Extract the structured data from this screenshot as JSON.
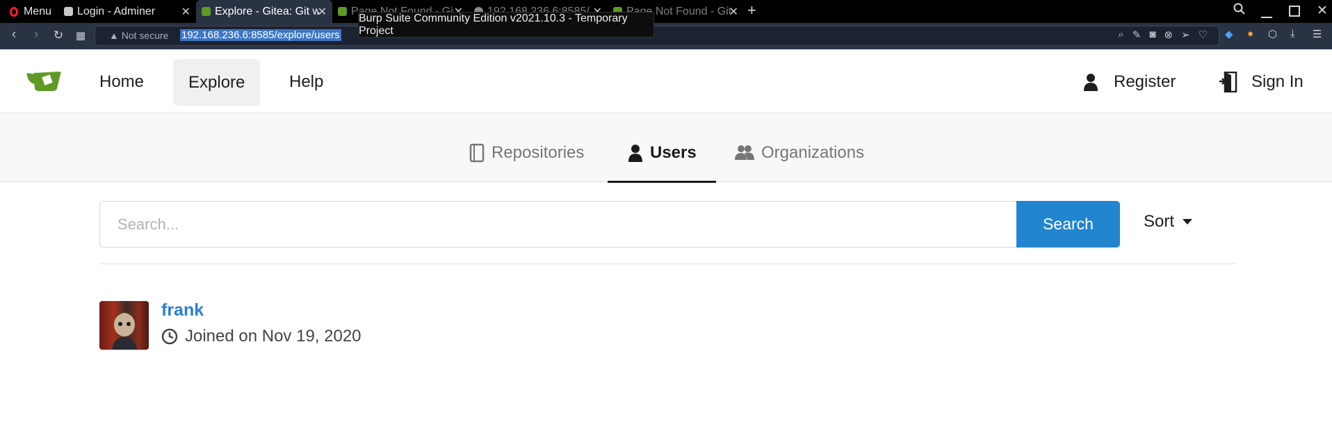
{
  "browser": {
    "menu_label": "Menu",
    "tabs": [
      {
        "title": "Login - Adminer"
      },
      {
        "title": "Explore - Gitea: Git w"
      },
      {
        "title": "Page Not Found - Gi"
      },
      {
        "title": "192.168.236.6:8585/"
      },
      {
        "title": "Page Not Found - Git"
      }
    ],
    "tooltip": "Burp Suite Community Edition v2021.10.3 - Temporary Project",
    "security_label": "Not secure",
    "url": "192.168.236.6:8585/explore/users"
  },
  "header": {
    "nav": [
      "Home",
      "Explore",
      "Help"
    ],
    "register_label": "Register",
    "signin_label": "Sign In"
  },
  "explore_tabs": {
    "repositories": "Repositories",
    "users": "Users",
    "organizations": "Organizations"
  },
  "search": {
    "placeholder": "Search...",
    "button_label": "Search",
    "sort_label": "Sort"
  },
  "users": [
    {
      "name": "frank",
      "joined": "Joined on Nov 19, 2020"
    }
  ]
}
